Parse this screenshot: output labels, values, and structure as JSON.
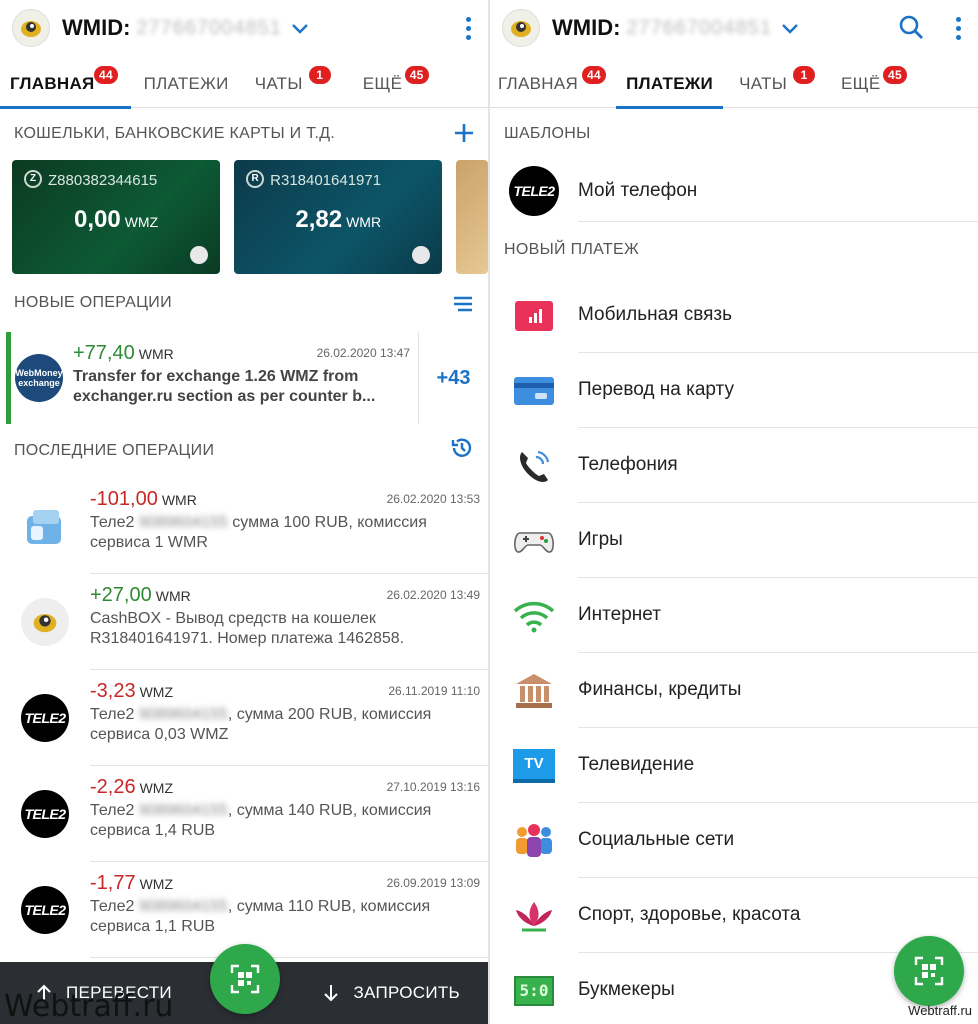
{
  "left": {
    "header": {
      "wmid_label": "WMID:",
      "wmid_value": "277667004851"
    },
    "tabs": [
      {
        "label": "ГЛАВНАЯ",
        "badge": "44"
      },
      {
        "label": "ПЛАТЕЖИ",
        "badge": ""
      },
      {
        "label": "ЧАТЫ",
        "badge": "1"
      },
      {
        "label": "ЕЩЁ",
        "badge": "45"
      }
    ],
    "wallets_title": "КОШЕЛЬКИ, БАНКОВСКИЕ КАРТЫ И Т.Д.",
    "cards": [
      {
        "number": "Z880382344615",
        "amount": "0,00",
        "currency": "WMZ"
      },
      {
        "number": "R318401641971",
        "amount": "2,82",
        "currency": "WMR"
      }
    ],
    "new_ops_title": "НОВЫЕ ОПЕРАЦИИ",
    "new_op": {
      "amount": "+77,40",
      "currency": "WMR",
      "date": "26.02.2020 13:47",
      "desc": "Transfer for exchange 1.26 WMZ from exchanger.ru section as per counter b...",
      "more": "+43",
      "logo_text": "WebMoney",
      "logo_sub": "exchange"
    },
    "last_ops_title": "ПОСЛЕДНИЕ ОПЕРАЦИИ",
    "ops": [
      {
        "amount": "-101,00",
        "currency": "WMR",
        "date": "26.02.2020 13:53",
        "pre": "Теле2",
        "hidden": "9089604155",
        "post": "сумма 100 RUB, комиссия сервиса 1 WMR"
      },
      {
        "amount": "+27,00",
        "currency": "WMR",
        "date": "26.02.2020 13:49",
        "pre": "CashBOX - Вывод средств на кошелек R318401641971. Номер платежа 1462858.",
        "hidden": "",
        "post": ""
      },
      {
        "amount": "-3,23",
        "currency": "WMZ",
        "date": "26.11.2019 11:10",
        "pre": "Теле2",
        "hidden": "9089604155",
        "post": ", сумма 200 RUB, комиссия сервиса 0,03 WMZ"
      },
      {
        "amount": "-2,26",
        "currency": "WMZ",
        "date": "27.10.2019 13:16",
        "pre": "Теле2",
        "hidden": "9089604155",
        "post": ", сумма 140 RUB, комиссия сервиса 1,4 RUB"
      },
      {
        "amount": "-1,77",
        "currency": "WMZ",
        "date": "26.09.2019 13:09",
        "pre": "Теле2",
        "hidden": "9089604155",
        "post": ", сумма 110 RUB, комиссия сервиса 1,1 RUB"
      }
    ],
    "tele2_logo": "TELE2",
    "bottom": {
      "transfer": "ПЕРЕВЕСТИ",
      "request": "ЗАПРОСИТЬ"
    },
    "watermark": "Webtraff.ru"
  },
  "right": {
    "header": {
      "wmid_label": "WMID:",
      "wmid_value": "277667004851"
    },
    "tabs": [
      {
        "label": "ГЛАВНАЯ",
        "badge": "44"
      },
      {
        "label": "ПЛАТЕЖИ",
        "badge": ""
      },
      {
        "label": "ЧАТЫ",
        "badge": "1"
      },
      {
        "label": "ЕЩЁ",
        "badge": "45"
      }
    ],
    "templates_title": "ШАБЛОНЫ",
    "template": {
      "label": "Мой телефон",
      "logo": "TELE2"
    },
    "new_payment_title": "НОВЫЙ ПЛАТЕЖ",
    "categories": [
      {
        "label": "Мобильная связь",
        "icon": "mobile-icon"
      },
      {
        "label": "Перевод на карту",
        "icon": "card-icon"
      },
      {
        "label": "Телефония",
        "icon": "phone-icon"
      },
      {
        "label": "Игры",
        "icon": "gamepad-icon"
      },
      {
        "label": "Интернет",
        "icon": "wifi-icon"
      },
      {
        "label": "Финансы, кредиты",
        "icon": "bank-icon"
      },
      {
        "label": "Телевидение",
        "icon": "tv-icon"
      },
      {
        "label": "Социальные сети",
        "icon": "people-icon"
      },
      {
        "label": "Спорт, здоровье, красота",
        "icon": "lotus-icon"
      },
      {
        "label": "Букмекеры",
        "icon": "scoreboard-icon"
      }
    ],
    "tv_text": "TV",
    "score_text": "5:0",
    "watermark": "Webtraff.ru"
  },
  "colors": {
    "accent": "#1a73c8",
    "badge": "#e02020",
    "positive": "#2e8b35",
    "negative": "#c62828",
    "fab": "#2ea84a"
  }
}
